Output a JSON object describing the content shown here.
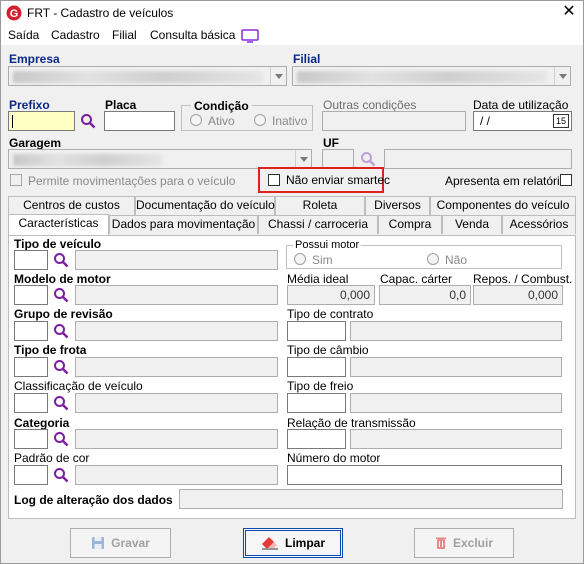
{
  "window": {
    "title": "FRT - Cadastro de veículos",
    "close": "✕"
  },
  "menu": {
    "items": [
      "Saída",
      "Cadastro",
      "Filial",
      "Consulta básica"
    ]
  },
  "form": {
    "empresa_label": "Empresa",
    "filial_label": "Filial",
    "prefixo_label": "Prefixo",
    "placa_label": "Placa",
    "condicao_label": "Condição",
    "ativo_label": "Ativo",
    "inativo_label": "Inativo",
    "outras_condicoes_label": "Outras condições",
    "data_utilizacao_label": "Data de utilização",
    "data_utilizacao_value": " /  /",
    "garagem_label": "Garagem",
    "uf_label": "UF",
    "permite_mov_label": "Permite movimentações para o veículo",
    "nao_enviar_smartec_label": "Não enviar smartec",
    "apresenta_relatorios_label": "Apresenta em relatórios",
    "calendar_icon_text": "15"
  },
  "tabs": {
    "row1": [
      "Centros de custos",
      "Documentação do veículo",
      "Roleta",
      "Diversos",
      "Componentes do veículo"
    ],
    "row2": [
      "Características",
      "Dados para movimentação",
      "Chassi / carroceria",
      "Compra",
      "Venda",
      "Acessórios"
    ]
  },
  "caracteristicas": {
    "tipo_veiculo_label": "Tipo de veículo",
    "possui_motor_label": "Possui motor",
    "sim_label": "Sim",
    "nao_label": "Não",
    "modelo_motor_label": "Modelo de motor",
    "media_ideal_label": "Média ideal",
    "media_ideal_value": "0,000",
    "capac_carter_label": "Capac. cárter",
    "capac_carter_value": "0,0",
    "repos_combust_label": "Repos. / Combust.",
    "repos_combust_value": "0,000",
    "grupo_revisao_label": "Grupo de revisão",
    "tipo_contrato_label": "Tipo de contrato",
    "tipo_frota_label": "Tipo de frota",
    "tipo_cambio_label": "Tipo de câmbio",
    "classificacao_label": "Classificação de veículo",
    "tipo_freio_label": "Tipo de freio",
    "categoria_label": "Categoria",
    "relacao_transmissao_label": "Relação de transmissão",
    "padrao_cor_label": "Padrão de cor",
    "numero_motor_label": "Número do motor",
    "log_label": "Log de alteração dos dados"
  },
  "buttons": {
    "gravar": "Gravar",
    "limpar": "Limpar",
    "excluir": "Excluir"
  },
  "colors": {
    "accent": "#0a2a8a",
    "highlight": "#e02020",
    "prefix_bg": "#ffffc4",
    "icon_purple": "#7a1fa2"
  }
}
